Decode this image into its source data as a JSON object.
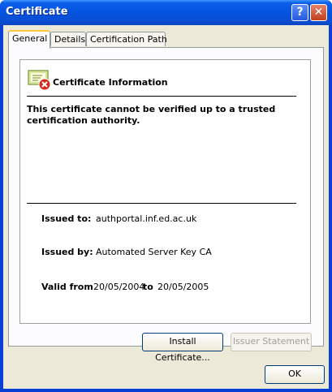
{
  "window": {
    "title": "Certificate",
    "help_label": "?",
    "close_label": "✕"
  },
  "tabs": [
    {
      "label": "General"
    },
    {
      "label": "Details"
    },
    {
      "label": "Certification Path"
    }
  ],
  "general": {
    "heading": "Certificate Information",
    "warning": "This certificate cannot be verified up to a trusted certification authority.",
    "issued_to_label": "Issued to:",
    "issued_to": "authportal.inf.ed.ac.uk",
    "issued_by_label": "Issued by:",
    "issued_by": "Automated Server Key CA",
    "valid_from_label": "Valid from",
    "valid_from": "20/05/2004",
    "to_label": "to",
    "valid_to": "20/05/2005"
  },
  "buttons": {
    "install": "Install Certificate...",
    "issuer_statement": "Issuer Statement",
    "ok": "OK"
  },
  "icons": {
    "certificate": "certificate-error-icon"
  }
}
